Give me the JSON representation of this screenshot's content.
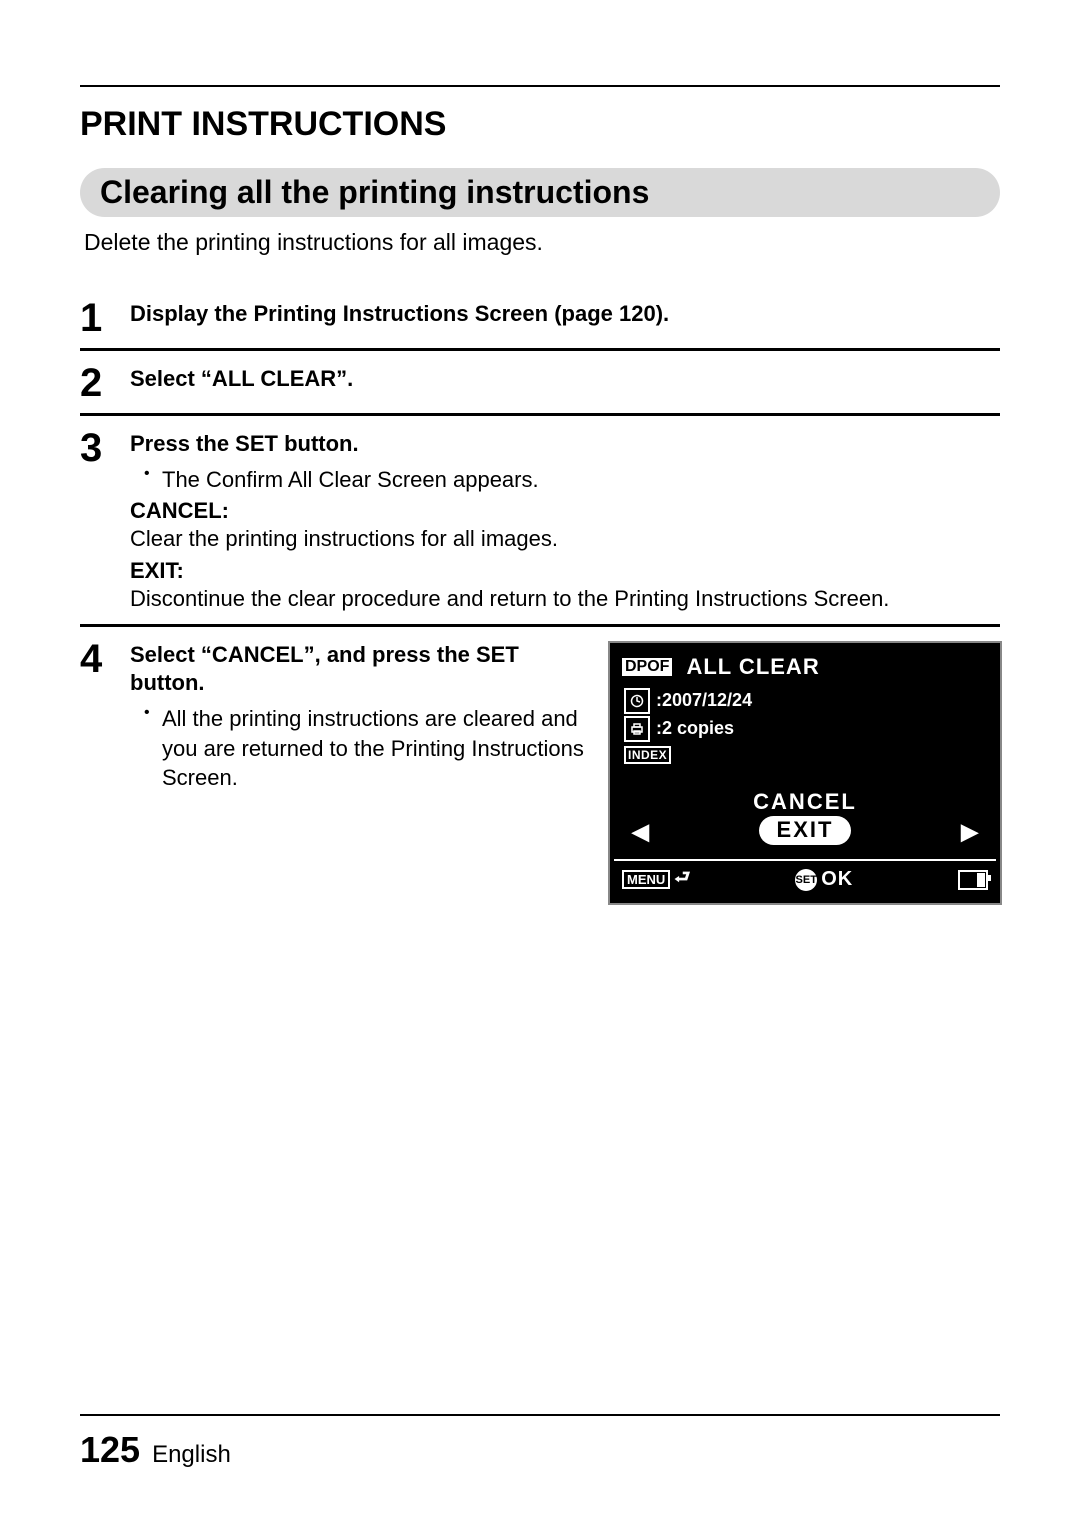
{
  "header": {
    "title": "PRINT INSTRUCTIONS"
  },
  "section": {
    "title": "Clearing all the printing instructions",
    "intro": "Delete the printing instructions for all images."
  },
  "steps": {
    "s1": {
      "num": "1",
      "head": "Display the Printing Instructions Screen (page 120)."
    },
    "s2": {
      "num": "2",
      "head": "Select “ALL CLEAR”."
    },
    "s3": {
      "num": "3",
      "head": "Press the SET button.",
      "bullet": "The Confirm All Clear Screen appears.",
      "cancel_label": "CANCEL:",
      "cancel_text": "Clear the printing instructions for all images.",
      "exit_label": "EXIT:",
      "exit_text": "Discontinue the clear procedure and return to the Printing Instructions Screen."
    },
    "s4": {
      "num": "4",
      "head": "Select “CANCEL”, and press the SET button.",
      "bullet": "All the printing instructions are cleared and you are returned to the Printing Instructions Screen."
    }
  },
  "lcd": {
    "dpof": "DPOF",
    "title": "ALL CLEAR",
    "date": ":2007/12/24",
    "copies": ":2 copies",
    "index": "INDEX",
    "cancel": "CANCEL",
    "exit": "EXIT",
    "left_arrow": "◀",
    "right_arrow": "▶",
    "menu": "MENU",
    "return": "↩",
    "set": "SET",
    "ok": "OK"
  },
  "footer": {
    "page": "125",
    "lang": "English"
  }
}
